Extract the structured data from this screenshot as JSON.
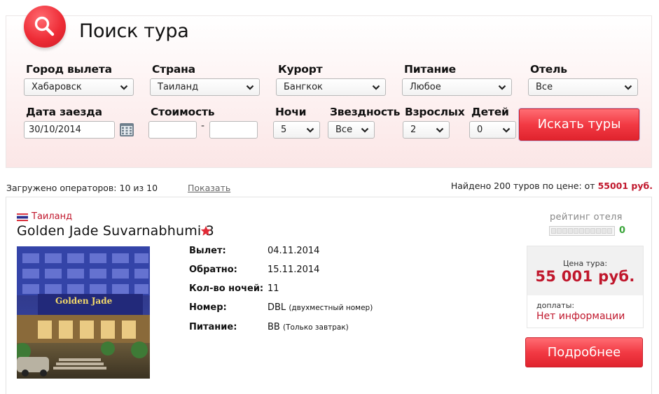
{
  "header": {
    "title": "Поиск тура"
  },
  "form": {
    "city_label": "Город вылета",
    "city_value": "Хабаровск",
    "country_label": "Страна",
    "country_value": "Таиланд",
    "resort_label": "Курорт",
    "resort_value": "Бангкок",
    "meal_label": "Питание",
    "meal_value": "Любое",
    "hotel_label": "Отель",
    "hotel_value": "Все",
    "date_label": "Дата заезда",
    "date_value": "30/10/2014",
    "cost_label": "Стоимость",
    "cost_from": "",
    "cost_to": "",
    "cost_dash": "-",
    "nights_label": "Ночи",
    "nights_value": "5",
    "stars_label": "Звездность",
    "stars_value": "Все",
    "adults_label": "Взрослых",
    "adults_value": "2",
    "children_label": "Детей",
    "children_value": "0",
    "search_button": "Искать туры"
  },
  "status": {
    "operators_text": "Загружено операторов: 10 из 10",
    "show_link": "Показать",
    "found_text": "Найдено 200 туров по цене: от",
    "found_price": "55001 руб."
  },
  "result": {
    "country": "Таиланд",
    "hotel_name": "Golden Jade Suvarnabhumi 3",
    "photo_sign": "Golden Jade",
    "details": [
      {
        "label": "Вылет:",
        "value": "04.11.2014",
        "note": ""
      },
      {
        "label": "Обратно:",
        "value": "15.11.2014",
        "note": ""
      },
      {
        "label": "Кол-во ночей:",
        "value": "11",
        "note": ""
      },
      {
        "label": "Номер:",
        "value": "DBL",
        "note": "(двухместный номер)"
      },
      {
        "label": "Питание:",
        "value": "BB",
        "note": "(Только завтрак)"
      }
    ],
    "rating_label": "рейтинг отеля",
    "rating_value": "0",
    "price_label": "Цена тура:",
    "price_value": "55 001 руб.",
    "extra_label": "доплаты:",
    "extra_value": "Нет информации",
    "more_button": "Подробнее"
  },
  "colors": {
    "accent": "#e8303a",
    "price": "#c0172c",
    "rating": "#3aa53a"
  }
}
